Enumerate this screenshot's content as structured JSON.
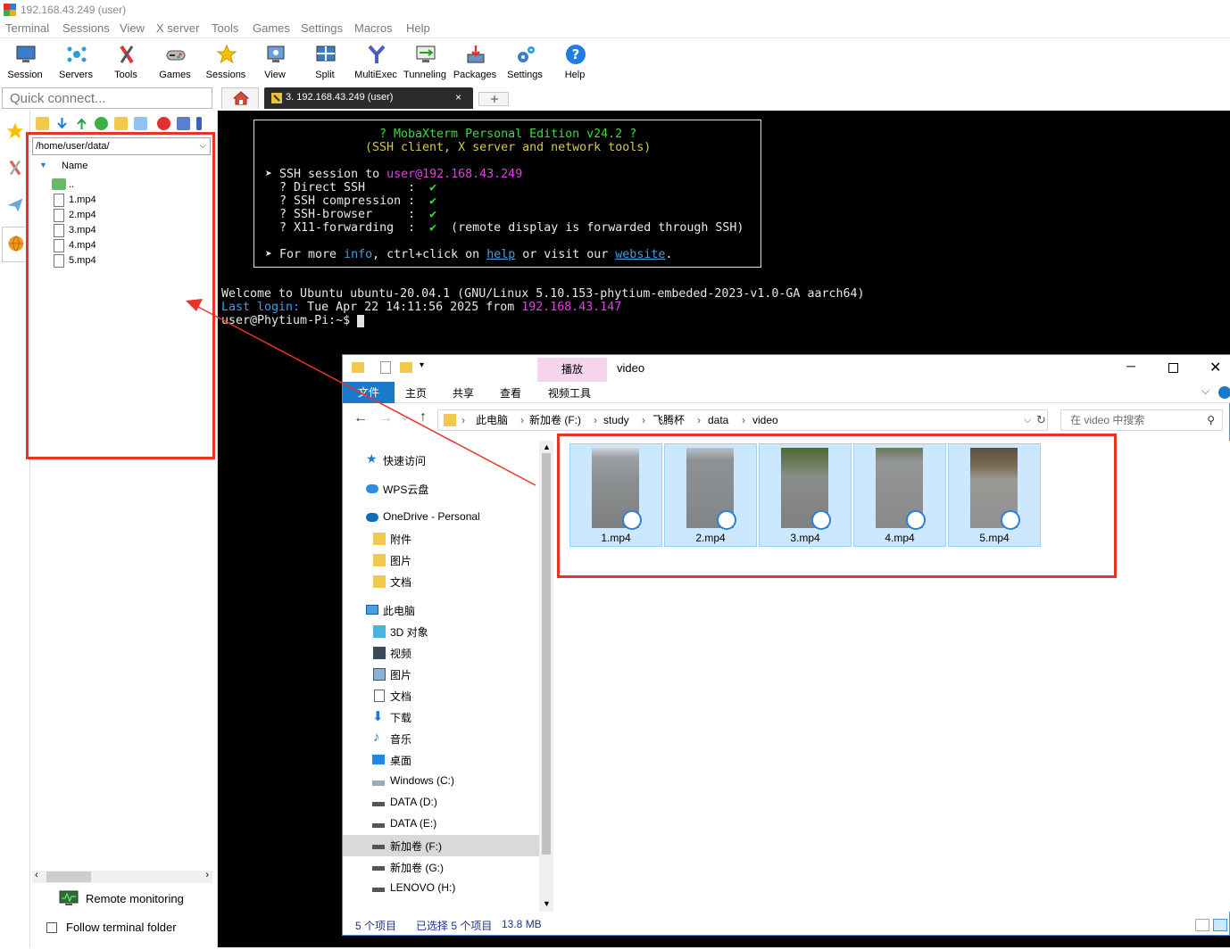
{
  "window": {
    "title": "192.168.43.249 (user)"
  },
  "menu": [
    "Terminal",
    "Sessions",
    "View",
    "X server",
    "Tools",
    "Games",
    "Settings",
    "Macros",
    "Help"
  ],
  "toolbar": [
    "Session",
    "Servers",
    "Tools",
    "Games",
    "Sessions",
    "View",
    "Split",
    "MultiExec",
    "Tunneling",
    "Packages",
    "Settings",
    "Help"
  ],
  "quick_connect": {
    "placeholder": "Quick connect..."
  },
  "session_tab": {
    "label": "3. 192.168.43.249 (user)",
    "close": "×"
  },
  "sftp": {
    "path": "/home/user/data/",
    "column": "Name",
    "parent": "..",
    "files": [
      "1.mp4",
      "2.mp4",
      "3.mp4",
      "4.mp4",
      "5.mp4"
    ],
    "remote_monitoring": "Remote monitoring",
    "follow_folder": "Follow terminal folder"
  },
  "terminal": {
    "banner_title": "? MobaXterm Personal Edition v24.2 ?",
    "banner_subtitle": "(SSH client, X server and network tools)",
    "session_prefix": "➤ SSH session to ",
    "session_target": "user@192.168.43.249",
    "features": [
      {
        "label": "? Direct SSH      :  ",
        "check": "✔",
        "note": ""
      },
      {
        "label": "? SSH compression :  ",
        "check": "✔",
        "note": ""
      },
      {
        "label": "? SSH-browser     :  ",
        "check": "✔",
        "note": ""
      },
      {
        "label": "? X11-forwarding  :  ",
        "check": "✔",
        "note": "  (remote display is forwarded through SSH)"
      }
    ],
    "more_prefix": "➤ For more ",
    "more_info": "info",
    "more_mid": ", ctrl+click on ",
    "more_help": "help",
    "more_mid2": " or visit our ",
    "more_website": "website",
    "more_end": ".",
    "welcome": "Welcome to Ubuntu ubuntu-20.04.1 (GNU/Linux 5.10.153-phytium-embeded-2023-v1.0-GA aarch64)",
    "last_login_label": "Last login:",
    "last_login_value": " Tue Apr 22 14:11:56 2025 from ",
    "last_login_ip": "192.168.43.147",
    "prompt": "user@Phytium-Pi:~$ "
  },
  "explorer": {
    "title": "video",
    "ribbon_context": "播放",
    "ribbon_tabs": [
      "文件",
      "主页",
      "共享",
      "查看"
    ],
    "ribbon_context_tab": "视频工具",
    "breadcrumb": [
      "此电脑",
      "新加卷 (F:)",
      "study",
      "飞腾杯",
      "data",
      "video"
    ],
    "search_placeholder": "在 video 中搜索",
    "nav": [
      "快速访问",
      "WPS云盘",
      "OneDrive - Personal",
      "附件",
      "图片",
      "文档",
      "此电脑",
      "3D 对象",
      "视频",
      "图片",
      "文档",
      "下载",
      "音乐",
      "桌面",
      "Windows (C:)",
      "DATA (D:)",
      "DATA (E:)",
      "新加卷 (F:)",
      "新加卷 (G:)",
      "LENOVO (H:)"
    ],
    "files": [
      "1.mp4",
      "2.mp4",
      "3.mp4",
      "4.mp4",
      "5.mp4"
    ],
    "status_count": "5 个项目",
    "status_selected": "已选择 5 个项目",
    "status_size": "13.8 MB"
  },
  "colors": {
    "terminal_bg": "#000000",
    "banner_green": "#3ddc3d",
    "banner_yellow": "#d6c84a",
    "magenta": "#e040e0",
    "link_blue": "#3aa0e8",
    "annotation_red": "#e8332a",
    "selection_blue": "#cce8ff"
  }
}
